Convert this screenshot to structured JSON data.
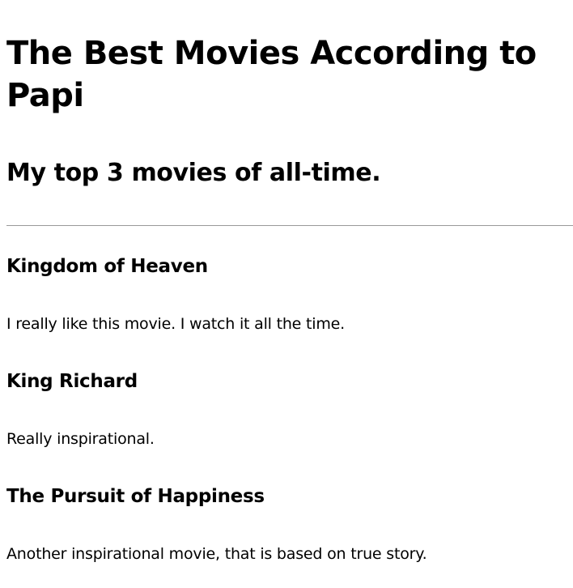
{
  "page": {
    "title": "The Best Movies According to Papi",
    "subtitle": "My top 3 movies of all-time."
  },
  "movies": [
    {
      "title": "Kingdom of Heaven",
      "description": "I really like this movie. I watch it all the time."
    },
    {
      "title": "King Richard",
      "description": "Really inspirational."
    },
    {
      "title": "The Pursuit of Happiness",
      "description": "Another inspirational movie, that is based on true story."
    }
  ]
}
